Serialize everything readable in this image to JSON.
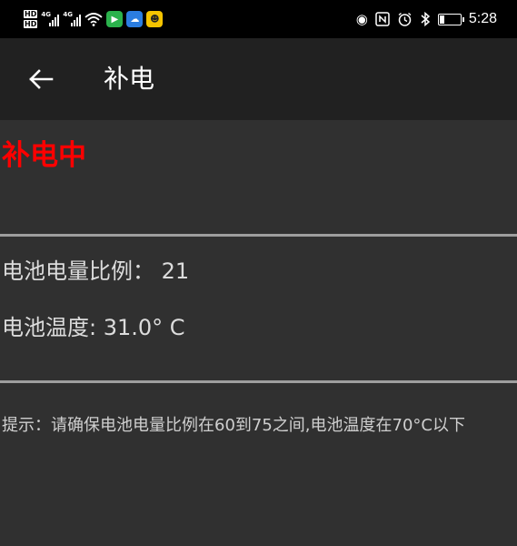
{
  "status_bar": {
    "hd_top": "HD",
    "hd_bottom": "HD",
    "sim1_net": "4G",
    "sim2_net": "4G",
    "time": "5:28"
  },
  "app_bar": {
    "title": "补电"
  },
  "main": {
    "status": "补电中",
    "battery_level_label": "电池电量比例：",
    "battery_level_value": "21",
    "battery_temp_label": "电池温度:",
    "battery_temp_value": "31.0° C",
    "hint": "提示：请确保电池电量比例在60到75之间,电池温度在70°C以下"
  },
  "colors": {
    "status_red": "#ff0000",
    "background": "#303030",
    "app_bar": "#212121"
  },
  "icons": [
    "back-arrow-icon",
    "eye-icon",
    "nfc-icon",
    "alarm-icon",
    "bluetooth-icon",
    "battery-charging-icon",
    "wifi-icon",
    "signal-icon"
  ]
}
